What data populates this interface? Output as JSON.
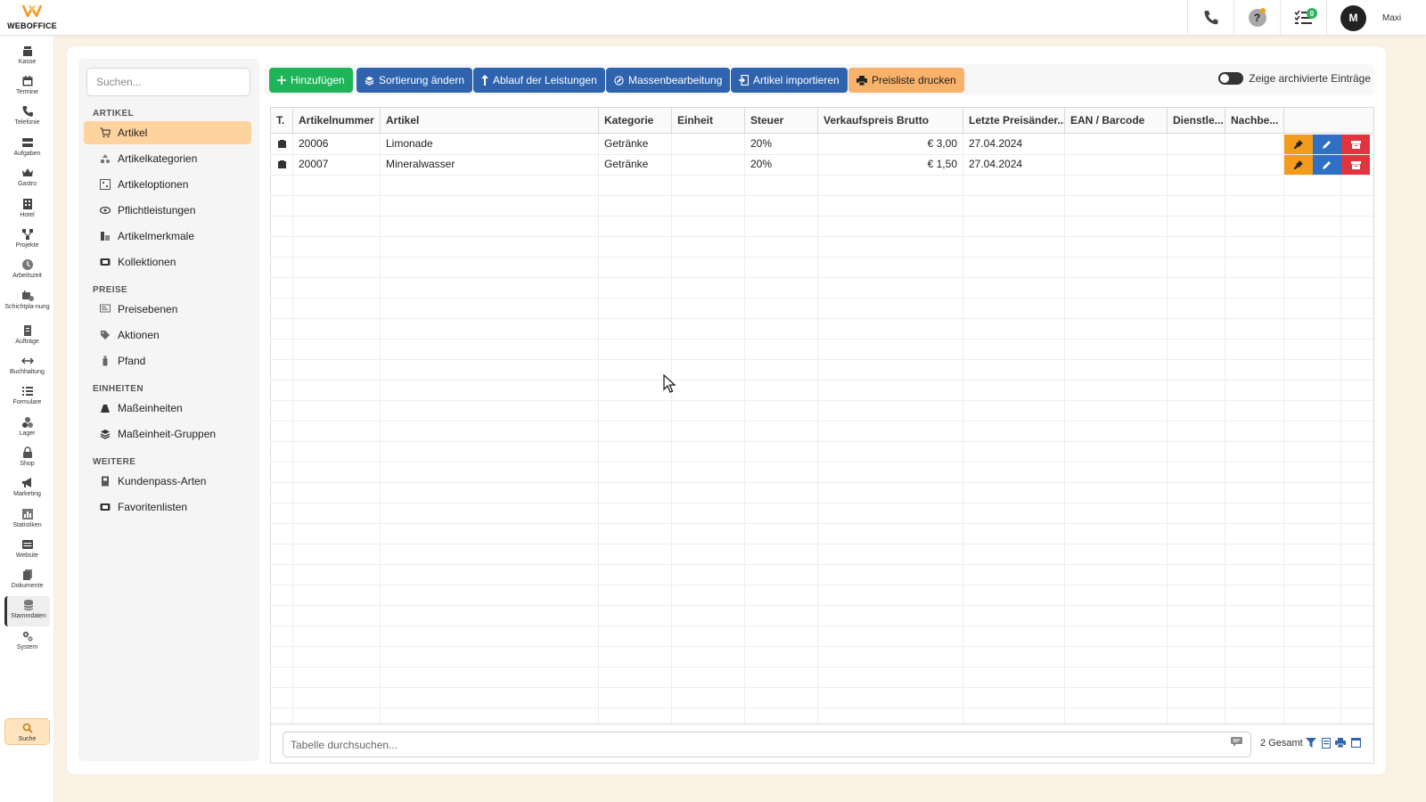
{
  "app": {
    "logo_text": "WEBOFFICE"
  },
  "topbar": {
    "user_initial": "M",
    "user_name": "Maxi",
    "tasks_badge": "0"
  },
  "leftnav": [
    {
      "label": "Kasse",
      "icon": "cash-register-icon"
    },
    {
      "label": "Termine",
      "icon": "calendar-icon"
    },
    {
      "label": "Telefonie",
      "icon": "phone-icon"
    },
    {
      "label": "Aufgaben",
      "icon": "tasks-icon"
    },
    {
      "label": "Gastro",
      "icon": "crown-icon"
    },
    {
      "label": "Hotel",
      "icon": "hotel-icon"
    },
    {
      "label": "Projekte",
      "icon": "project-icon"
    },
    {
      "label": "Arbeitszeit",
      "icon": "clock-icon"
    },
    {
      "label": "Schichtpla-nung",
      "icon": "shift-icon"
    },
    {
      "label": "Aufträge",
      "icon": "orders-icon"
    },
    {
      "label": "Buchhaltung",
      "icon": "arrows-icon"
    },
    {
      "label": "Formulare",
      "icon": "form-icon"
    },
    {
      "label": "Lager",
      "icon": "boxes-icon"
    },
    {
      "label": "Shop",
      "icon": "lock-icon"
    },
    {
      "label": "Marketing",
      "icon": "megaphone-icon"
    },
    {
      "label": "Statistiken",
      "icon": "chart-icon"
    },
    {
      "label": "Website",
      "icon": "website-icon"
    },
    {
      "label": "Dokumente",
      "icon": "documents-icon"
    },
    {
      "label": "Stammdaten",
      "icon": "database-icon"
    },
    {
      "label": "System",
      "icon": "gears-icon"
    }
  ],
  "nav_search_label": "Suche",
  "sidebar": {
    "search_placeholder": "Suchen...",
    "sections": [
      {
        "title": "ARTIKEL",
        "items": [
          "Artikel",
          "Artikelkategorien",
          "Artikeloptionen",
          "Pflichtleistungen",
          "Artikelmerkmale",
          "Kollektionen"
        ]
      },
      {
        "title": "PREISE",
        "items": [
          "Preisebenen",
          "Aktionen",
          "Pfand"
        ]
      },
      {
        "title": "EINHEITEN",
        "items": [
          "Maßeinheiten",
          "Maßeinheit-Gruppen"
        ]
      },
      {
        "title": "WEITERE",
        "items": [
          "Kundenpass-Arten",
          "Favoritenlisten"
        ]
      }
    ],
    "active_item": "Artikel"
  },
  "toolbar": {
    "add": "Hinzufügen",
    "sort": "Sortierung ändern",
    "flow": "Ablauf der Leistungen",
    "bulk": "Massenbearbeitung",
    "import": "Artikel importieren",
    "print": "Preisliste drucken",
    "archived_toggle": "Zeige archivierte Einträge"
  },
  "table": {
    "columns": [
      "T.",
      "Artikelnummer",
      "Artikel",
      "Kategorie",
      "Einheit",
      "Steuer",
      "Verkaufspreis Brutto",
      "Letzte Preisänder...",
      "EAN / Barcode",
      "Dienstle...",
      "Nachbe..."
    ],
    "rows": [
      {
        "nummer": "20006",
        "artikel": "Limonade",
        "kategorie": "Getränke",
        "einheit": "",
        "steuer": "20%",
        "preis": "€ 3,00",
        "letzte": "27.04.2024",
        "ean": "",
        "dienst": "",
        "nachbe": ""
      },
      {
        "nummer": "20007",
        "artikel": "Mineralwasser",
        "kategorie": "Getränke",
        "einheit": "",
        "steuer": "20%",
        "preis": "€ 1,50",
        "letzte": "27.04.2024",
        "ean": "",
        "dienst": "",
        "nachbe": ""
      }
    ],
    "search_placeholder": "Tabelle durchsuchen...",
    "total": "2 Gesamt"
  },
  "colors": {
    "accent": "#ffd39e",
    "green": "#1fb35a",
    "blue": "#2f63ae",
    "orange": "#f8b26a",
    "red": "#e0343f"
  }
}
